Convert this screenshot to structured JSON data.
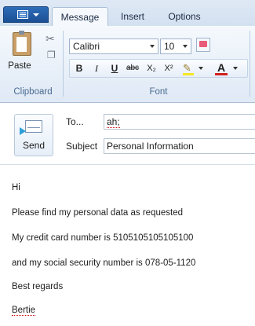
{
  "tabs": {
    "message": "Message",
    "insert": "Insert",
    "options": "Options"
  },
  "ribbon": {
    "clipboard": {
      "paste_label": "Paste",
      "group_label": "Clipboard"
    },
    "font": {
      "font_name": "Calibri",
      "font_size": "10",
      "bold": "B",
      "italic": "I",
      "underline": "U",
      "strikethrough": "abc",
      "subscript": "X₂",
      "superscript": "X²",
      "font_color_glyph": "A",
      "group_label": "Font"
    }
  },
  "header": {
    "send_label": "Send",
    "to_label": "To...",
    "to_value": "ah;",
    "subject_label": "Subject",
    "subject_value": "Personal Information"
  },
  "message": {
    "lines": [
      "Hi",
      "Please find my personal data as requested",
      "My credit card number is 5105105105105100",
      "and my social security number is 078-05-1120",
      "Best regards",
      "Bertie"
    ]
  },
  "colors": {
    "ribbon_bg": "#dfe9f5",
    "app_button": "#1b4f94",
    "highlight": "#f6e626",
    "font_color": "#d42020"
  }
}
